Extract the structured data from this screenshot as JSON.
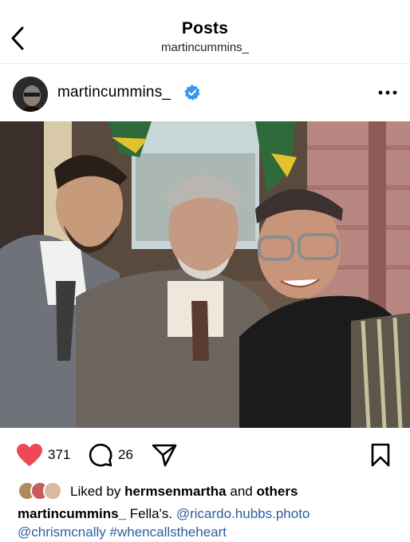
{
  "nav": {
    "title": "Posts",
    "subtitle": "martincummins_"
  },
  "post": {
    "username": "martincummins_",
    "verified": true,
    "likes": "371",
    "comments": "26"
  },
  "liked_by": {
    "prefix": "Liked by",
    "user": "hermsenmartha",
    "and": "and",
    "others": "others"
  },
  "caption": {
    "username": "martincummins_",
    "text": "Fella's.",
    "mention1": "@ricardo.hubbs.photo",
    "mention2": "@chrismcnally",
    "hashtag": "#whencallstheheart"
  },
  "colors": {
    "heart": "#ed4956",
    "verified": "#3797f0",
    "link": "#2f5e9e"
  }
}
